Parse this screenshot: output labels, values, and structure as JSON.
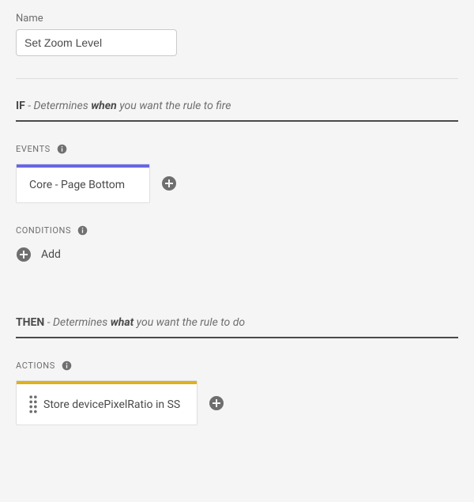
{
  "name": {
    "label": "Name",
    "value": "Set Zoom Level"
  },
  "if": {
    "prefix": "IF",
    "desc_1": "- Determines",
    "desc_2": "when",
    "desc_3": "you want the rule to fire"
  },
  "events": {
    "label": "EVENTS",
    "items": [
      {
        "text": "Core - Page Bottom"
      }
    ]
  },
  "conditions": {
    "label": "CONDITIONS",
    "add_text": "Add"
  },
  "then": {
    "prefix": "THEN",
    "desc_1": "- Determines",
    "desc_2": "what",
    "desc_3": "you want the rule to do"
  },
  "actions": {
    "label": "ACTIONS",
    "items": [
      {
        "text": "Store devicePixelRatio in SS"
      }
    ]
  }
}
